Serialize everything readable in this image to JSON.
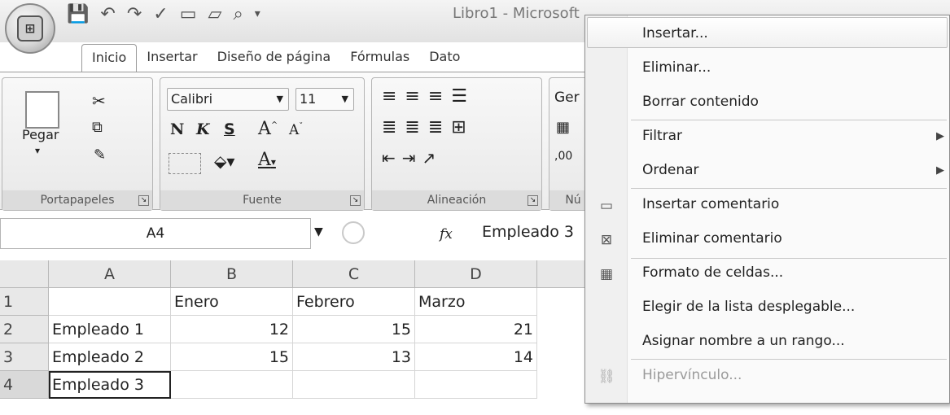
{
  "window": {
    "title": "Libro1 - Microsoft",
    "qat_icons": [
      "save-icon",
      "undo-icon",
      "redo-icon",
      "spelling-icon",
      "new-icon",
      "open-icon",
      "print-preview-icon"
    ]
  },
  "tabs": [
    "Inicio",
    "Insertar",
    "Diseño de página",
    "Fórmulas",
    "Dato"
  ],
  "ribbon": {
    "clipboard": {
      "label": "Portapapeles",
      "paste": "Pegar"
    },
    "font": {
      "label": "Fuente",
      "name": "Calibri",
      "size": "11",
      "bold": "N",
      "italic": "K",
      "underline": "S",
      "grow": "A",
      "shrink": "A",
      "color": "A"
    },
    "alignment": {
      "label": "Alineación"
    },
    "number": {
      "label": "Nú",
      "format": "Ger",
      "decimals": ",00"
    }
  },
  "formula_bar": {
    "namebox": "A4",
    "fx": "fx",
    "content": "Empleado 3"
  },
  "grid": {
    "columns": [
      "A",
      "B",
      "C",
      "D"
    ],
    "rows": [
      {
        "n": "1",
        "cells": [
          "",
          "Enero",
          "Febrero",
          "Marzo"
        ]
      },
      {
        "n": "2",
        "cells": [
          "Empleado 1",
          "12",
          "15",
          "21"
        ]
      },
      {
        "n": "3",
        "cells": [
          "Empleado 2",
          "15",
          "13",
          "14"
        ]
      },
      {
        "n": "4",
        "cells": [
          "Empleado 3",
          "",
          "",
          ""
        ]
      }
    ]
  },
  "context_menu": {
    "items": [
      {
        "label": "Insertar...",
        "enabled": true
      },
      {
        "label": "Eliminar...",
        "enabled": true
      },
      {
        "label": "Borrar contenido",
        "enabled": true
      },
      {
        "label": "Filtrar",
        "enabled": true,
        "submenu": true
      },
      {
        "label": "Ordenar",
        "enabled": true,
        "submenu": true
      },
      {
        "label": "Insertar comentario",
        "enabled": true,
        "icon": "insert-comment-icon"
      },
      {
        "label": "Eliminar comentario",
        "enabled": true,
        "icon": "delete-comment-icon"
      },
      {
        "label": "Formato de celdas...",
        "enabled": true,
        "icon": "format-cells-icon"
      },
      {
        "label": "Elegir de la lista desplegable...",
        "enabled": true
      },
      {
        "label": "Asignar nombre a un rango...",
        "enabled": true
      },
      {
        "label": "Hipervínculo...",
        "enabled": false,
        "icon": "hyperlink-icon"
      }
    ]
  }
}
